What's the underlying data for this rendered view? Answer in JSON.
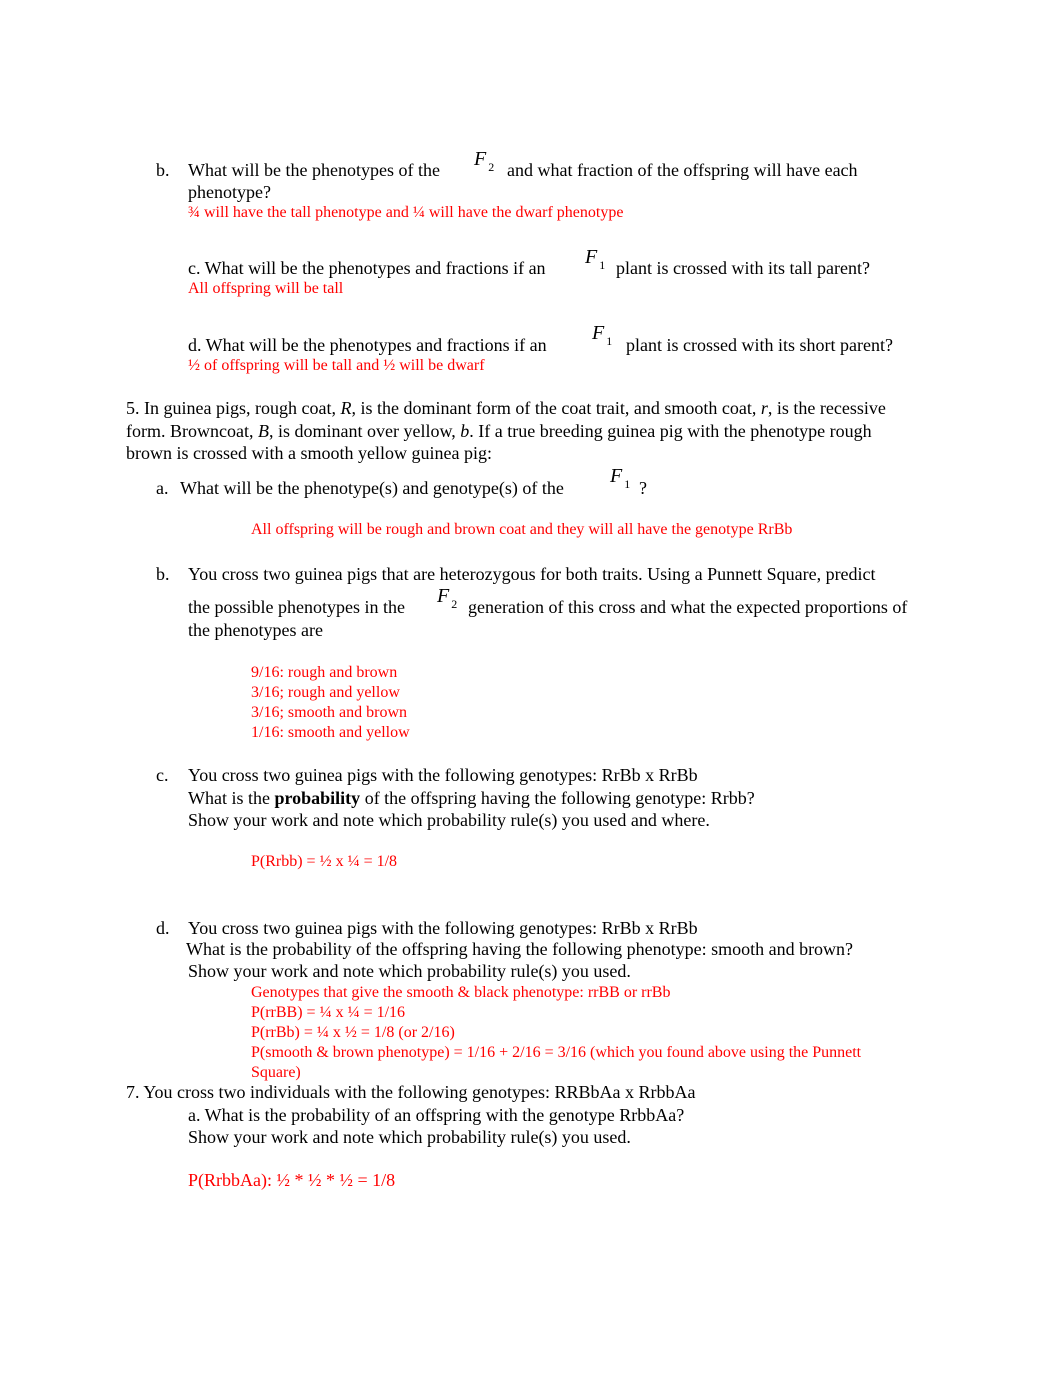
{
  "doc": {
    "q4b": {
      "label": "b.",
      "text_pre": "What will be the phenotypes of the",
      "f_var": "F",
      "f_sub": "2",
      "text_post": "and what fraction of the offspring will have each",
      "text_line2": "phenotype?",
      "answer": "¾ will have the tall phenotype and ¼ will have the dwarf phenotype"
    },
    "q4c": {
      "text_pre": "c. What will be the phenotypes and fractions if an",
      "f_var": "F",
      "f_sub": "1",
      "text_post": "plant is crossed with its tall parent?",
      "answer": "All offspring will be tall"
    },
    "q4d": {
      "text_pre": "d.  What will be the phenotypes and fractions if an",
      "f_var": "F",
      "f_sub": "1",
      "text_post": "plant is crossed with its short parent?",
      "answer": "½  of offspring will be tall and ½ will be dwarf"
    },
    "q5": {
      "intro_l1_a": "5.  In guinea pigs, rough coat, ",
      "intro_l1_R": "R",
      "intro_l1_b": ", is the dominant form of the coat trait, and smooth coat, ",
      "intro_l1_r": "r",
      "intro_l1_c": ", is the recessive",
      "intro_l2_a": "form.  Browncoat, ",
      "intro_l2_B": "B",
      "intro_l2_b": ", is dominant over yellow, ",
      "intro_l2_bb": "b",
      "intro_l2_c": ".  If a true breeding guinea pig with the phenotype rough",
      "intro_l3": "brown is crossed with a smooth yellow guinea pig:",
      "a": {
        "label": "a.",
        "text_pre": "What will be the phenotype(s)  and genotype(s) of the",
        "f_var": "F",
        "f_sub": "1",
        "text_post": "?",
        "answer": "All offspring will be rough and brown coat and they will all have the genotype RrBb"
      },
      "b": {
        "label": "b.",
        "line1": "You cross two guinea pigs that are heterozygous for both traits.  Using a Punnett Square, predict",
        "line2_pre": "the possible phenotypes in the",
        "f_var": "F",
        "f_sub": "2",
        "line2_post": "generation of this cross and what the expected proportions of",
        "line3": "the phenotypes are",
        "answers": [
          "9/16: rough and brown",
          "3/16; rough and yellow",
          "3/16; smooth and brown",
          "1/16: smooth and yellow"
        ]
      },
      "c": {
        "label": "c.",
        "line1": "You cross two guinea pigs with the following genotypes:  RrBb x RrBb",
        "line2_pre": "What is the ",
        "line2_bold": "probability",
        "line2_post": " of the offspring having the following genotype: Rrbb?",
        "line3": "Show your work and note which probability rule(s) you used and where.",
        "answer": "P(Rrbb) = ½ x ¼ = 1/8"
      },
      "d": {
        "label": "d.",
        "line1": "You cross two guinea pigs with the following genotypes: RrBb x RrBb",
        "line2": " What is the probability of the offspring having the following phenotype:    smooth and brown?",
        "line3": "Show your work and note which probability rule(s) you used.",
        "answers": [
          "Genotypes that give the smooth & black phenotype: rrBB or rrBb",
          "P(rrBB) = ¼ x ¼ = 1/16",
          "P(rrBb) = ¼ x ½ = 1/8 (or 2/16)",
          "P(smooth & brown phenotype) = 1/16 + 2/16 = 3/16 (which you found above using the Punnett",
          "Square)"
        ]
      }
    },
    "q7": {
      "line1": "7. You cross two individuals with the following genotypes:  RRBbAa    x   RrbbAa",
      "a_line1": "a. What is the probability of an offspring with the genotype   RrbbAa?",
      "a_line2": "Show your work and note which probability rule(s) you used.",
      "answer": "P(RrbbAa): ½ * ½ * ½ = 1/8"
    }
  }
}
